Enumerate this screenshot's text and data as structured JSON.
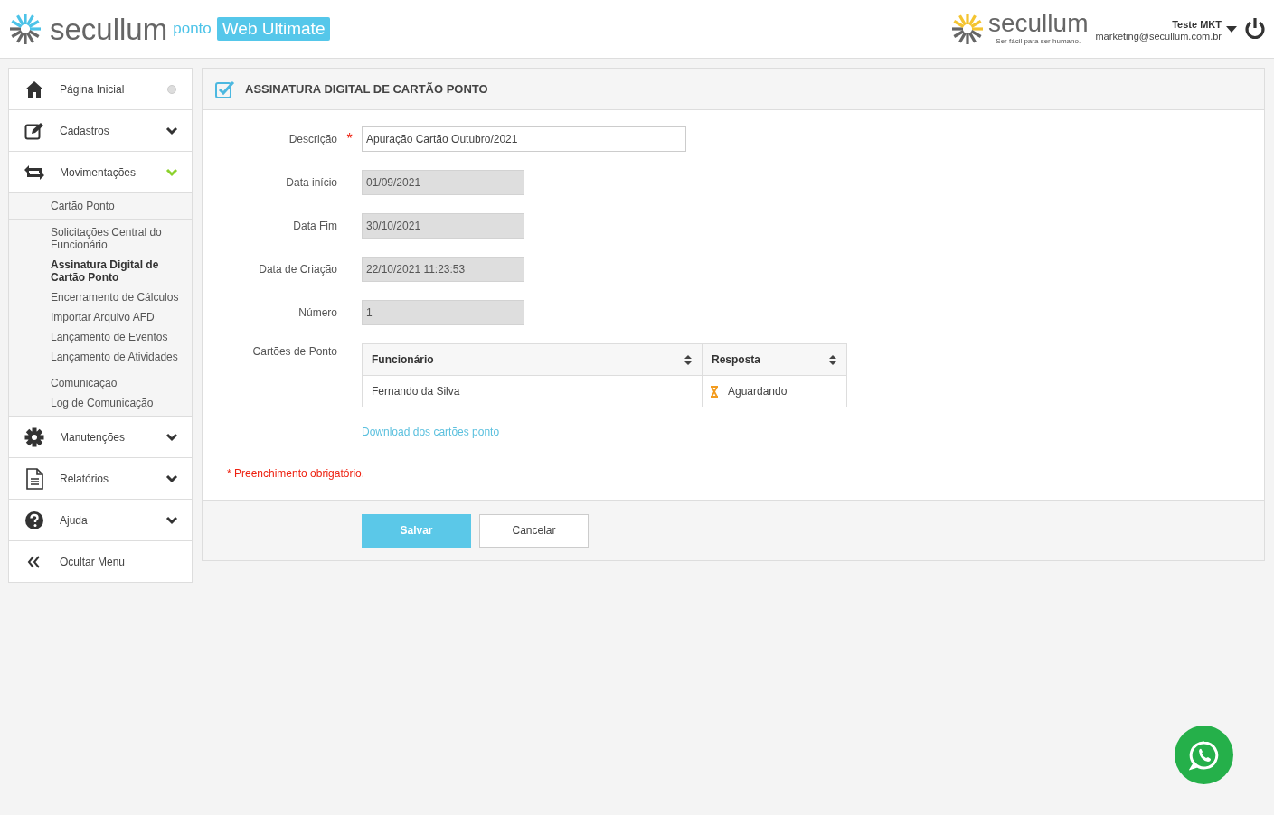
{
  "header": {
    "brand": "secullum",
    "product": "ponto",
    "edition": "Web Ultimate",
    "partner_brand": "secullum",
    "partner_tagline": "Ser fácil para ser humano.",
    "user_name": "Teste MKT",
    "user_email": "marketing@secullum.com.br"
  },
  "sidebar": {
    "items": [
      {
        "label": "Página Inicial",
        "kind": "link"
      },
      {
        "label": "Cadastros",
        "kind": "menu",
        "expanded": false
      },
      {
        "label": "Movimentações",
        "kind": "menu",
        "expanded": true,
        "groups": [
          [
            {
              "label": "Cartão Ponto",
              "selected": false
            }
          ],
          [
            {
              "label": "Solicitações Central do Funcionário",
              "selected": false
            },
            {
              "label": "Assinatura Digital de Cartão Ponto",
              "selected": true
            },
            {
              "label": "Encerramento de Cálculos",
              "selected": false
            },
            {
              "label": "Importar Arquivo AFD",
              "selected": false
            },
            {
              "label": "Lançamento de Eventos",
              "selected": false
            },
            {
              "label": "Lançamento de Atividades",
              "selected": false
            }
          ],
          [
            {
              "label": "Comunicação",
              "selected": false
            },
            {
              "label": "Log de Comunicação",
              "selected": false
            }
          ]
        ]
      },
      {
        "label": "Manutenções",
        "kind": "menu",
        "expanded": false
      },
      {
        "label": "Relatórios",
        "kind": "menu",
        "expanded": false
      },
      {
        "label": "Ajuda",
        "kind": "menu",
        "expanded": false
      },
      {
        "label": "Ocultar Menu",
        "kind": "link"
      }
    ]
  },
  "panel": {
    "title": "ASSINATURA DIGITAL DE CARTÃO PONTO",
    "fields": [
      {
        "label": "Descrição",
        "required_mark": "*",
        "value": "Apuração Cartão Outubro/2021",
        "disabled": false
      },
      {
        "label": "Data início",
        "value": "01/09/2021",
        "disabled": true
      },
      {
        "label": "Data Fim",
        "value": "30/10/2021",
        "disabled": true
      },
      {
        "label": "Data de Criação",
        "value": "22/10/2021 11:23:53",
        "disabled": true
      },
      {
        "label": "Número",
        "value": "1",
        "disabled": true
      }
    ],
    "table_label": "Cartões de Ponto",
    "table": {
      "columns": [
        "Funcionário",
        "Resposta"
      ],
      "rows": [
        {
          "employee": "Fernando da Silva",
          "response": "Aguardando"
        }
      ]
    },
    "download_link": "Download dos cartões ponto",
    "required_note": "* Preenchimento obrigatório.",
    "buttons": [
      {
        "label": "Salvar",
        "kind": "primary"
      },
      {
        "label": "Cancelar",
        "kind": "secondary"
      }
    ]
  }
}
